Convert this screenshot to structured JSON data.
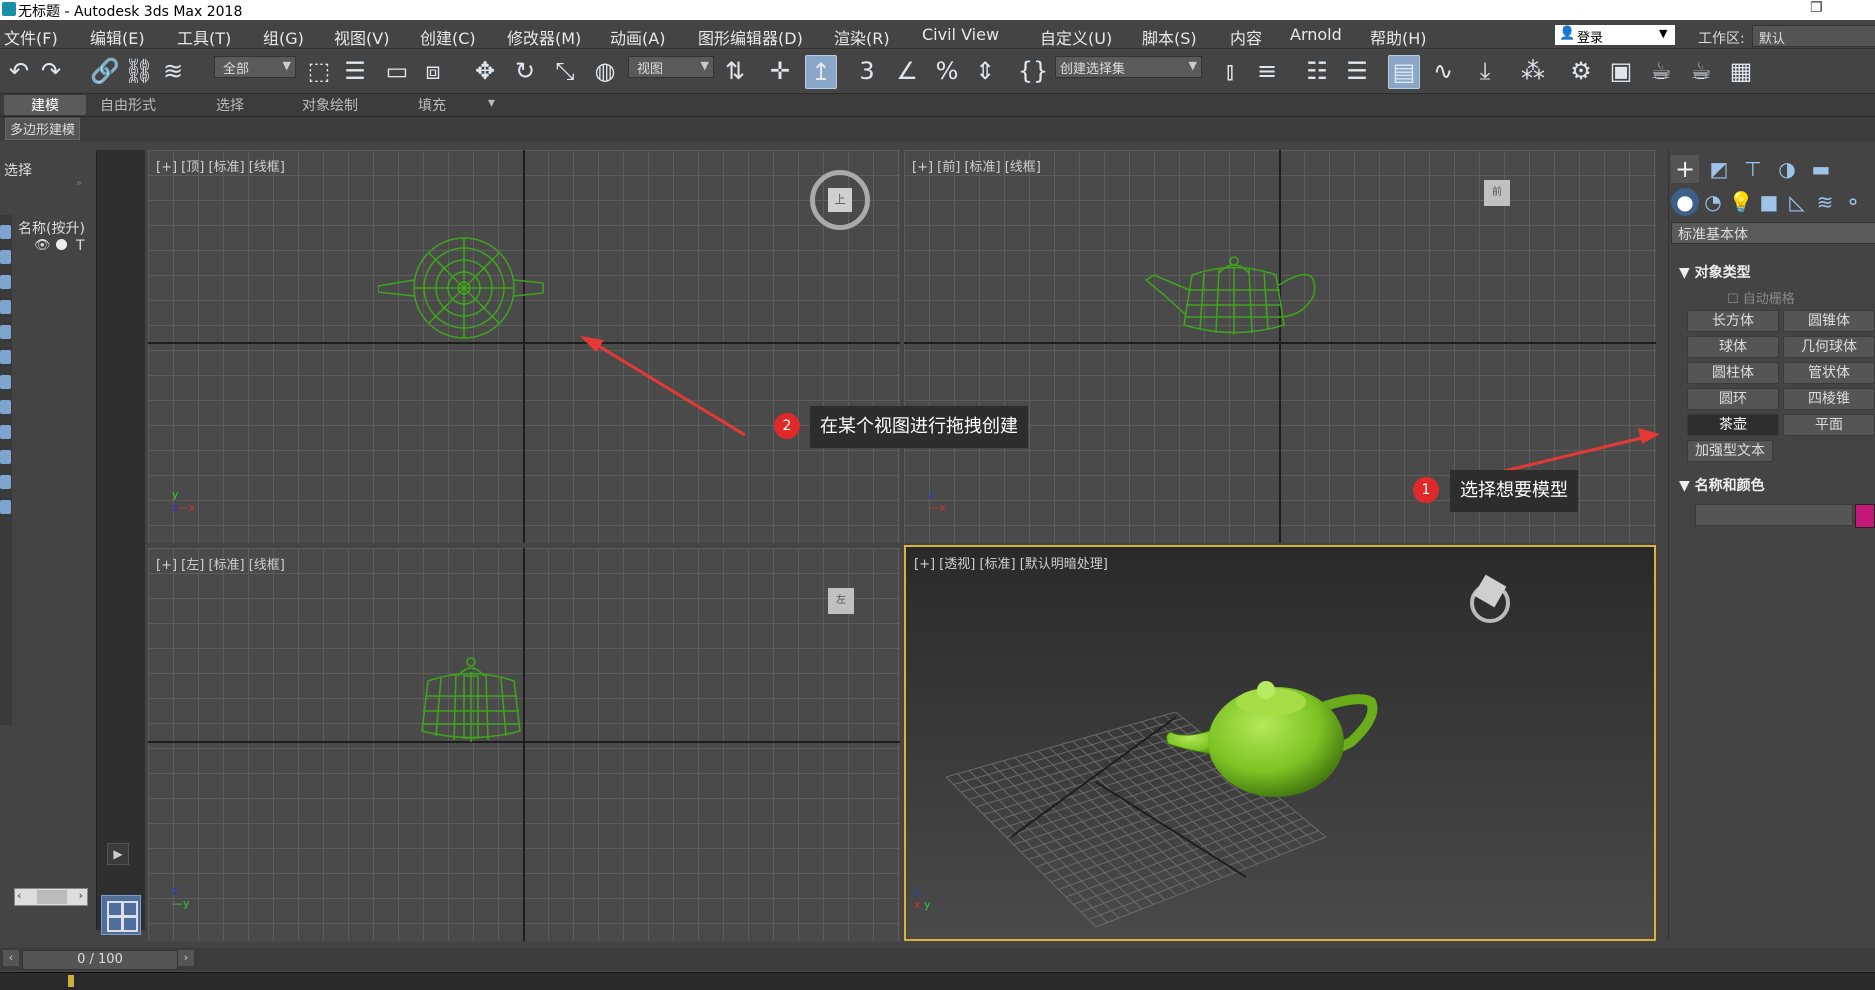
{
  "titlebar": {
    "title": "无标题 - Autodesk 3ds Max 2018",
    "restore": "❐"
  },
  "menu": [
    "文件(F)",
    "编辑(E)",
    "工具(T)",
    "组(G)",
    "视图(V)",
    "创建(C)",
    "修改器(M)",
    "动画(A)",
    "图形编辑器(D)",
    "渲染(R)",
    "Civil View",
    "自定义(U)",
    "脚本(S)",
    "内容",
    "Arnold",
    "帮助(H)"
  ],
  "login": {
    "label": "登录",
    "icon": "person-icon"
  },
  "workspace": {
    "label": "工作区:",
    "value": "默认"
  },
  "toolbar": {
    "selection_filter": "全部",
    "reference_coord": "视图",
    "named_selection": "创建选择集"
  },
  "ribbon": {
    "tabs": [
      "建模",
      "自由形式",
      "选择",
      "对象绘制",
      "填充"
    ],
    "active_tab": "建模",
    "sub_label": "多边形建模"
  },
  "explorer": {
    "title": "选择",
    "column": "名称(按升)",
    "row_t": "T"
  },
  "viewports": [
    {
      "name": "top",
      "label": "[+] [顶] [标准] [线框]"
    },
    {
      "name": "front",
      "label": "[+] [前] [标准] [线框]"
    },
    {
      "name": "left",
      "label": "[+] [左] [标准] [线框]"
    },
    {
      "name": "perspective",
      "label": "[+] [透视] [标准] [默认明暗处理]"
    }
  ],
  "viewcube": {
    "top": "上",
    "front": "前",
    "left": "左"
  },
  "command_panel": {
    "category": "标准基本体",
    "object_type_title": "对象类型",
    "autogrid": "自动栅格",
    "buttons": [
      "长方体",
      "圆锥体",
      "球体",
      "几何球体",
      "圆柱体",
      "管状体",
      "圆环",
      "四棱锥",
      "茶壶",
      "平面"
    ],
    "selected": "茶壶",
    "extended_text": "加强型文本",
    "name_color_title": "名称和颜色",
    "swatch_color": "#c2187a"
  },
  "callouts": [
    {
      "number": "1",
      "text": "选择想要模型"
    },
    {
      "number": "2",
      "text": "在某个视图进行拖拽创建"
    }
  ],
  "timeline": {
    "frame": "0 / 100"
  },
  "colors": {
    "wire": "#3fa51b",
    "teapot": "#7cc323",
    "arrow": "#e53935",
    "active_border": "#d7b33c"
  }
}
